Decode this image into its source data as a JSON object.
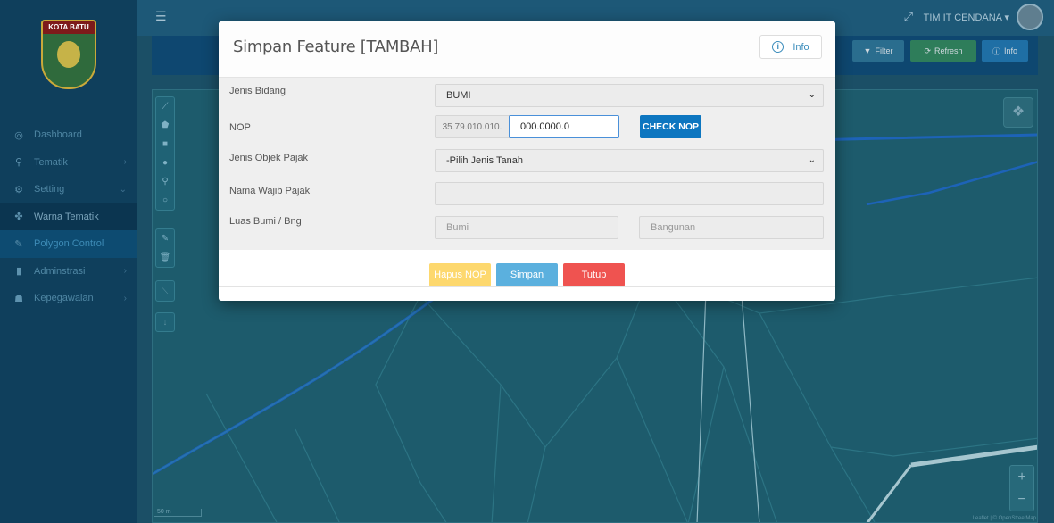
{
  "sidebar": {
    "logo_text": "KOTA BATU",
    "items": [
      {
        "icon": "dashboard-icon",
        "glyph": "◎",
        "label": "Dashboard",
        "chevron": ""
      },
      {
        "icon": "map-pin-icon",
        "glyph": "⚲",
        "label": "Tematik",
        "chevron": "›"
      },
      {
        "icon": "gears-icon",
        "glyph": "⚙",
        "label": "Setting",
        "chevron": "⌄"
      },
      {
        "icon": "paint-icon",
        "glyph": "✤",
        "label": "Warna Tematik",
        "chevron": ""
      },
      {
        "icon": "edit-icon",
        "glyph": "✎",
        "label": "Polygon Control",
        "chevron": ""
      },
      {
        "icon": "file-icon",
        "glyph": "▮",
        "label": "Adminstrasi",
        "chevron": "›"
      },
      {
        "icon": "users-icon",
        "glyph": "☗",
        "label": "Kepegawaian",
        "chevron": "›"
      }
    ]
  },
  "topbar": {
    "user_name": "TIM IT CENDANA ▾",
    "toggle_glyph": "☰",
    "expand_glyph": "⤢"
  },
  "panel": {
    "filter_label": "Filter",
    "refresh_label": "Refresh",
    "info_label": "Info"
  },
  "map": {
    "scale_label": "50 m",
    "attribution": "Leaflet | © OpenStreetMap",
    "zoom_in": "+",
    "zoom_out": "−"
  },
  "modal": {
    "title": "Simpan Feature [TAMBAH]",
    "info_label": "Info",
    "fields": {
      "jenis_bidang": {
        "label": "Jenis Bidang",
        "value": "BUMI"
      },
      "nop": {
        "label": "NOP",
        "prefix": "35.79.010.010.",
        "value": "000.0000.0",
        "check_label": "CHECK NOP"
      },
      "jenis_objek": {
        "label": "Jenis Objek Pajak",
        "value": "-Pilih Jenis Tanah"
      },
      "nama_wajib": {
        "label": "Nama Wajib Pajak",
        "value": ""
      },
      "luas": {
        "label": "Luas Bumi / Bng",
        "bumi_placeholder": "Bumi",
        "bangunan_placeholder": "Bangunan"
      }
    },
    "buttons": {
      "hapus": "Hapus NOP",
      "simpan": "Simpan",
      "tutup": "Tutup"
    }
  },
  "colors": {
    "check_nop": "#0d76c0",
    "hapus": "#fdd86e",
    "simpan": "#5bb0de",
    "tutup": "#ef5350"
  }
}
